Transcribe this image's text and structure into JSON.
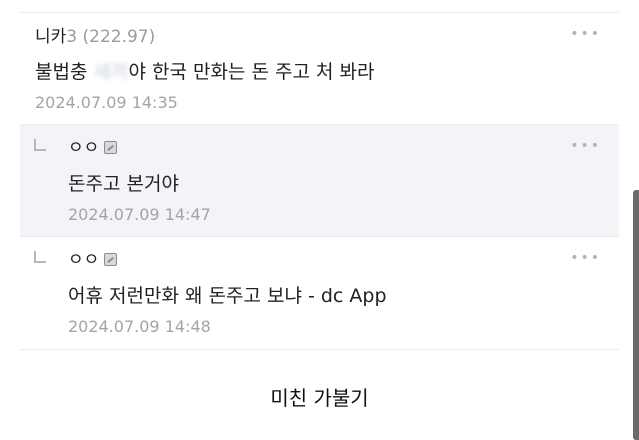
{
  "comments": [
    {
      "author": "니카",
      "ip": "3 (222.97)",
      "text_before": "불법충 ",
      "text_blurred": "새끼",
      "text_after": "야 한국 만화는 돈 주고 처 봐라",
      "date": "2024.07.09 14:35"
    }
  ],
  "replies": [
    {
      "author": "ㅇㅇ",
      "text": "돈주고 본거야",
      "date": "2024.07.09 14:47"
    },
    {
      "author": "ㅇㅇ",
      "text": "어휴 저런만화 왜 돈주고 보냐 - dc App",
      "date": "2024.07.09 14:48"
    }
  ],
  "more_icon": "more-dots-icon",
  "more_label": "•••",
  "caption": "미친 가불기",
  "colors": {
    "reply_background": "#f3f4f8",
    "date_text": "#a4a4a4",
    "ip_text": "#9a9a9a"
  }
}
